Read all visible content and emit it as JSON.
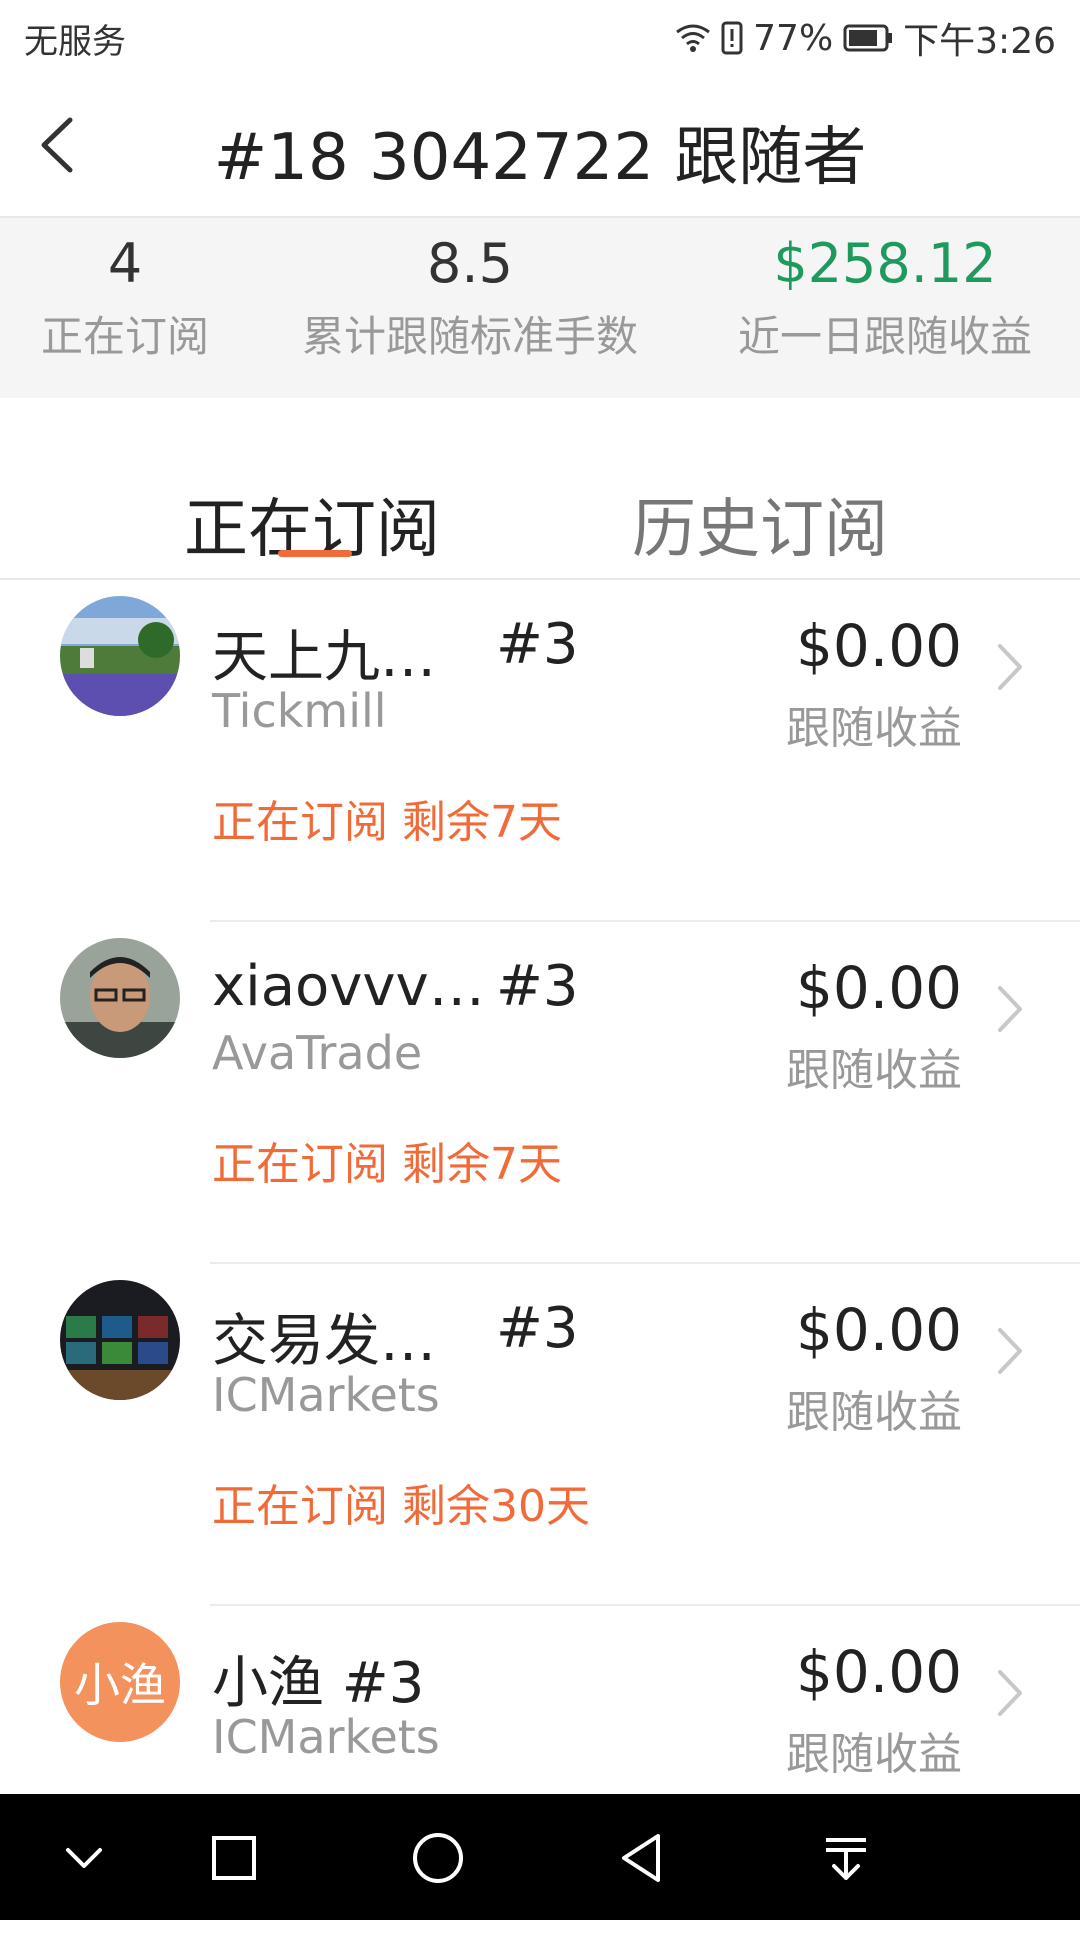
{
  "status_bar": {
    "carrier": "无服务",
    "battery": "77%",
    "time": "下午3:26"
  },
  "header": {
    "title": "#18 3042722 跟随者"
  },
  "stats": [
    {
      "value": "4",
      "label": "正在订阅"
    },
    {
      "value": "8.5",
      "label": "累计跟随标准手数"
    },
    {
      "value": "$258.12",
      "label": "近一日跟随收益"
    }
  ],
  "tabs": [
    {
      "label": "正在订阅"
    },
    {
      "label": "历史订阅"
    }
  ],
  "items": [
    {
      "name": "天上九…",
      "rank": "#3",
      "broker": "Tickmill",
      "amount": "$0.00",
      "amount_label": "跟随收益",
      "status": "正在订阅 剩余7天"
    },
    {
      "name": "xiaovvv…",
      "rank": "#3",
      "broker": "AvaTrade",
      "amount": "$0.00",
      "amount_label": "跟随收益",
      "status": "正在订阅 剩余7天"
    },
    {
      "name": "交易发…",
      "rank": "#3",
      "broker": "ICMarkets",
      "amount": "$0.00",
      "amount_label": "跟随收益",
      "status": "正在订阅 剩余30天"
    },
    {
      "name": "小渔 #3",
      "avatar_text": "小渔",
      "broker": "ICMarkets",
      "amount": "$0.00",
      "amount_label": "跟随收益"
    }
  ],
  "icons": {
    "back": "chevron-left-icon",
    "row_arrow": "chevron-right-icon",
    "nav": [
      "chevron-down-icon",
      "square-icon",
      "circle-icon",
      "triangle-back-icon",
      "pull-down-icon"
    ]
  },
  "colors": {
    "accent": "#f16b39",
    "positive": "#1f9a5e"
  }
}
